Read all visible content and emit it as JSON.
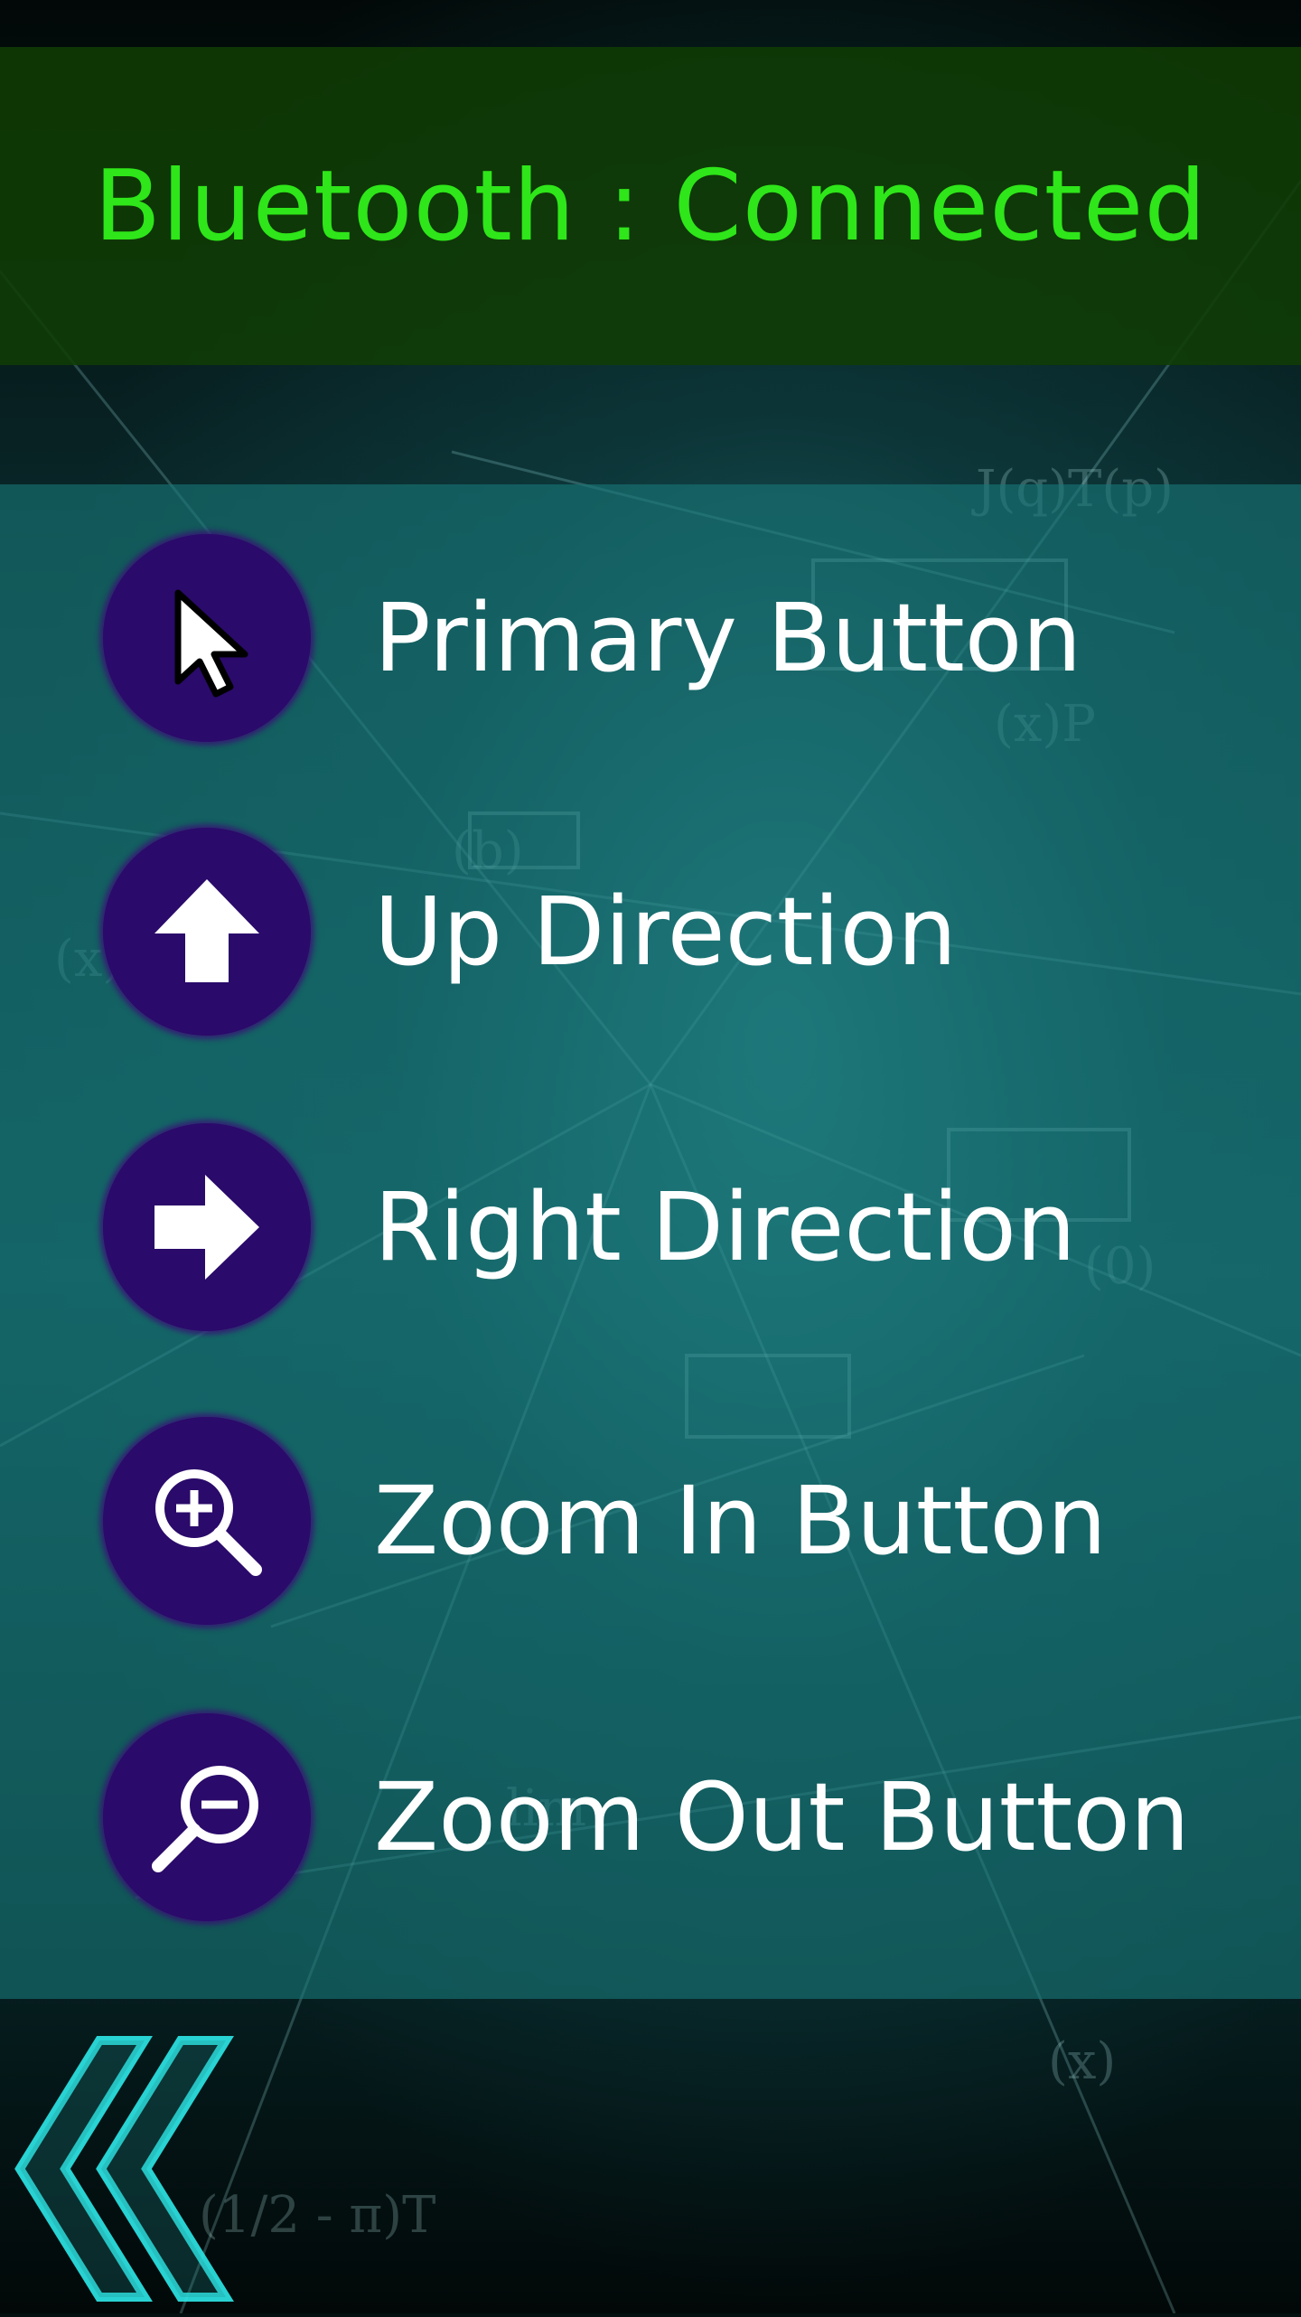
{
  "header": {
    "title": "Bluetooth : Connected"
  },
  "menu": {
    "items": [
      {
        "label": "Primary Button",
        "icon": "cursor-icon"
      },
      {
        "label": "Up Direction",
        "icon": "arrow-up-icon"
      },
      {
        "label": "Right Direction",
        "icon": "arrow-right-icon"
      },
      {
        "label": "Zoom In Button",
        "icon": "zoom-in-icon"
      },
      {
        "label": "Zoom Out Button",
        "icon": "zoom-out-icon"
      }
    ]
  },
  "footer": {
    "back_icon": "double-chevron-left-icon"
  },
  "colors": {
    "header_text": "#2ee619",
    "header_band": "#103c04",
    "panel": "#187678",
    "icon_circle": "#2a0a6a",
    "label_text": "#ffffff"
  }
}
